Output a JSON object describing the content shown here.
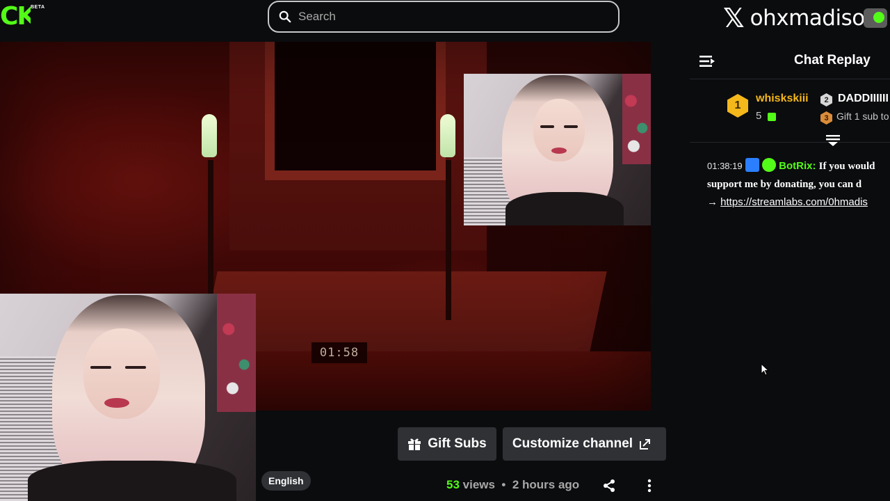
{
  "header": {
    "logo": "CK",
    "logo_badge": "BETA",
    "search": {
      "placeholder": "Search",
      "value": ""
    },
    "watermark": {
      "icon": "x-logo-icon",
      "handle": "ohxmadison"
    }
  },
  "video": {
    "clock_display": "01:58"
  },
  "chat": {
    "title": "Chat Replay",
    "leaderboard": [
      {
        "rank": "1",
        "name": "whiskskiii",
        "subs": "5",
        "name_color": "#f5b81b"
      },
      {
        "rank": "2",
        "name": "DADDIIIIII",
        "subtext": "Gift 1 sub to",
        "rank3": "3"
      }
    ],
    "messages": [
      {
        "time": "01:38:19",
        "user": "BotRix",
        "text": "If you would support me by donating, you can d",
        "arrow": "→",
        "link": "https://streamlabs.com/0hmadis"
      }
    ]
  },
  "actions": {
    "gift_subs": "Gift Subs",
    "customize": "Customize channel"
  },
  "stream_info": {
    "language": "English",
    "views_count": "53",
    "views_label": " views",
    "separator": "•",
    "time_ago": "2 hours ago"
  },
  "colors": {
    "brand": "#53fc18",
    "background": "#0b0c0e",
    "button": "#2f3135"
  }
}
